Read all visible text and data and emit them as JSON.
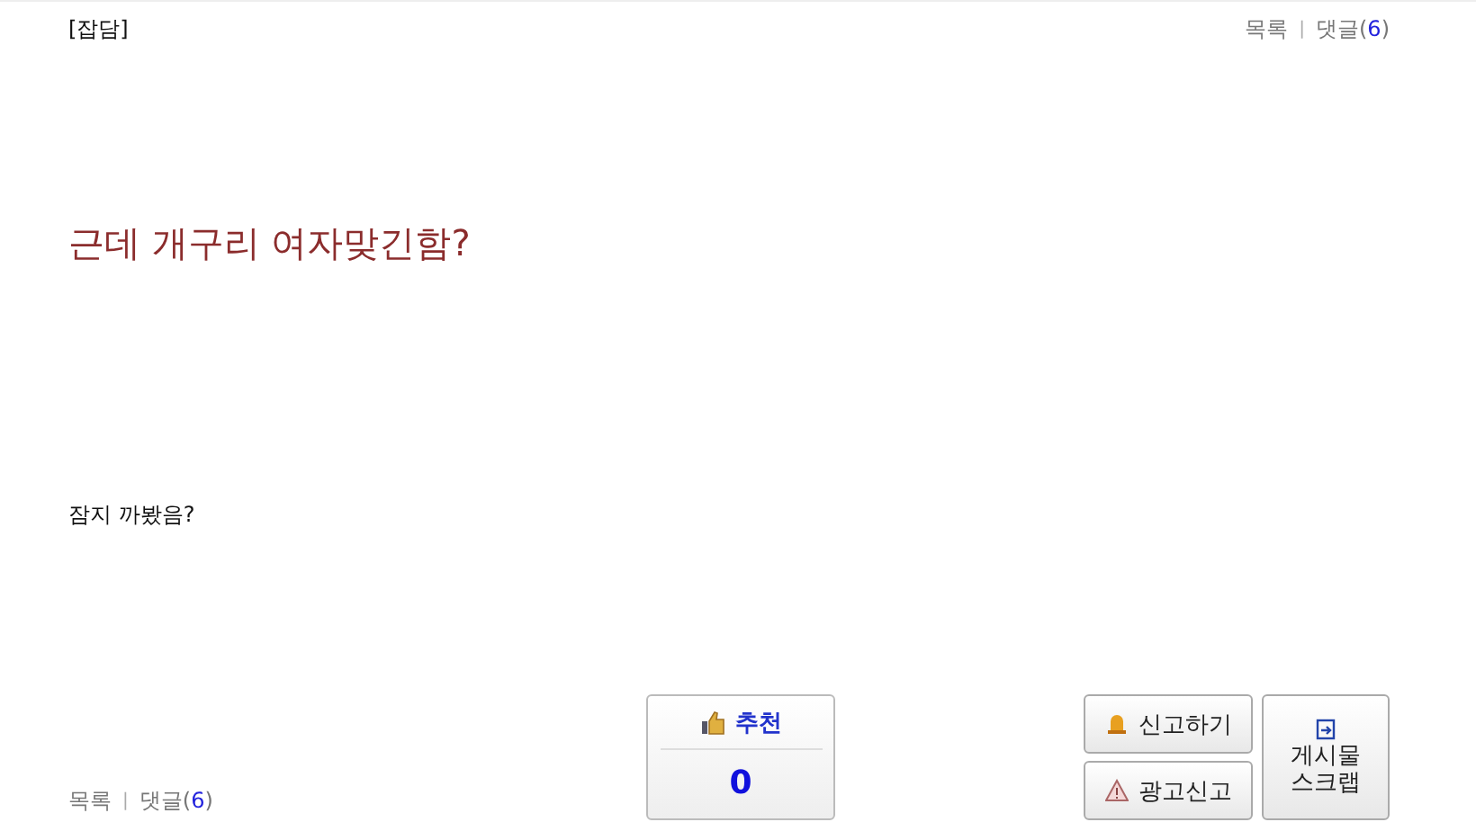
{
  "category": "[잡담]",
  "top_nav": {
    "list_link": "목록",
    "separator": "|",
    "comments_link": {
      "label": "댓글(",
      "count": "6",
      "tail": ")"
    }
  },
  "title": "근데 개구리 여자맞긴함?",
  "body": "잠지 까봤음?",
  "recommend": {
    "label": "추천",
    "count": "0"
  },
  "report_buttons": [
    "신고하기",
    "광고신고"
  ],
  "scrap_button": "게시물\n스크랩",
  "bottom_nav": {
    "list_link": "목록",
    "separator": "|",
    "comments_link": {
      "label": "댓글(",
      "count": "6",
      "tail": ")"
    }
  }
}
